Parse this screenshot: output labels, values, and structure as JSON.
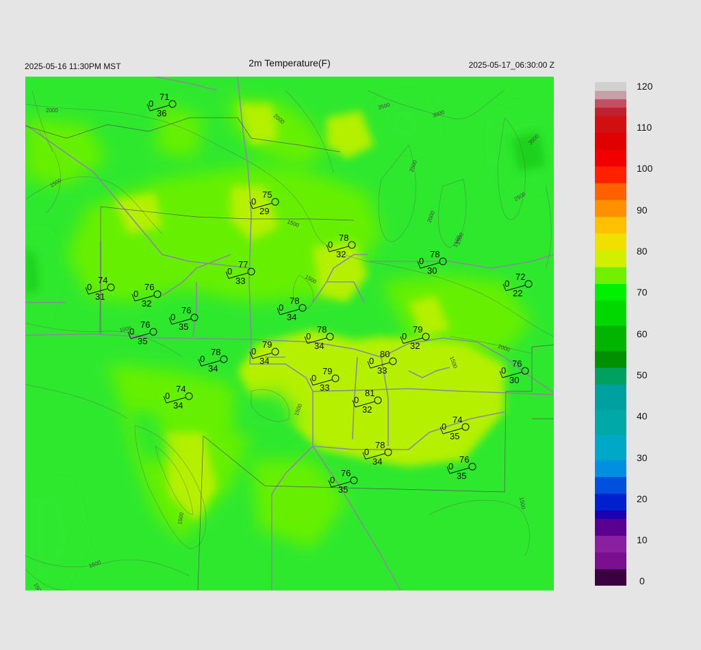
{
  "header": {
    "title": "2m Temperature(F)",
    "local_time": "2025-05-16 11:30PM MST",
    "utc_time": "2025-05-17_06:30:00 Z"
  },
  "colorbar": {
    "ticks": [
      "120",
      "110",
      "100",
      "90",
      "80",
      "70",
      "60",
      "50",
      "40",
      "30",
      "20",
      "10",
      "0"
    ],
    "range": [
      0,
      120
    ],
    "stops": [
      {
        "v": 0,
        "c": "#000000"
      },
      {
        "v": 3,
        "c": "#3a0040"
      },
      {
        "v": 8,
        "c": "#7a1090"
      },
      {
        "v": 12,
        "c": "#8a20a0"
      },
      {
        "v": 15,
        "c": "#5a0090"
      },
      {
        "v": 18,
        "c": "#1a00b0"
      },
      {
        "v": 22,
        "c": "#0020d0"
      },
      {
        "v": 26,
        "c": "#0050e0"
      },
      {
        "v": 30,
        "c": "#0090e0"
      },
      {
        "v": 35,
        "c": "#00a8c8"
      },
      {
        "v": 42,
        "c": "#00a8a8"
      },
      {
        "v": 48,
        "c": "#00a0a0"
      },
      {
        "v": 52,
        "c": "#00a060"
      },
      {
        "v": 56,
        "c": "#009000"
      },
      {
        "v": 62,
        "c": "#00b400"
      },
      {
        "v": 68,
        "c": "#00d800"
      },
      {
        "v": 72,
        "c": "#00f000"
      },
      {
        "v": 76,
        "c": "#70f000"
      },
      {
        "v": 80,
        "c": "#d0f000"
      },
      {
        "v": 84,
        "c": "#f0e000"
      },
      {
        "v": 88,
        "c": "#ffc000"
      },
      {
        "v": 92,
        "c": "#ff9000"
      },
      {
        "v": 96,
        "c": "#ff6000"
      },
      {
        "v": 100,
        "c": "#ff2000"
      },
      {
        "v": 104,
        "c": "#f00000"
      },
      {
        "v": 108,
        "c": "#e00000"
      },
      {
        "v": 112,
        "c": "#d01010"
      },
      {
        "v": 114,
        "c": "#c02030"
      },
      {
        "v": 116,
        "c": "#c05060"
      },
      {
        "v": 118,
        "c": "#c8a0a8"
      },
      {
        "v": 120,
        "c": "#d0d0d0"
      }
    ]
  },
  "map": {
    "field_colors": {
      "cool": "#2ee82e",
      "mid": "#66f000",
      "warm": "#b4f000",
      "cold": "#1ad21a"
    },
    "contour_labels": [
      "2000",
      "2000",
      "3500",
      "3000",
      "3500",
      "2500",
      "2500",
      "2000",
      "1500",
      "1500",
      "1500",
      "1500",
      "1000",
      "1500",
      "2000",
      "1500",
      "1500",
      "1500",
      "1500",
      "1500",
      "1500"
    ],
    "stations": [
      {
        "t": "71",
        "d": "36",
        "z": "0"
      },
      {
        "t": "75",
        "d": "29",
        "z": "0"
      },
      {
        "t": "78",
        "d": "32",
        "z": "0"
      },
      {
        "t": "77",
        "d": "33",
        "z": "0"
      },
      {
        "t": "78",
        "d": "30",
        "z": "0"
      },
      {
        "t": "74",
        "d": "31",
        "z": "0"
      },
      {
        "t": "76",
        "d": "32",
        "z": "0"
      },
      {
        "t": "72",
        "d": "22",
        "z": "0"
      },
      {
        "t": "78",
        "d": "34",
        "z": "0"
      },
      {
        "t": "76",
        "d": "35",
        "z": "0"
      },
      {
        "t": "76",
        "d": "35",
        "z": "0"
      },
      {
        "t": "78",
        "d": "34",
        "z": "0"
      },
      {
        "t": "79",
        "d": "32",
        "z": "0"
      },
      {
        "t": "79",
        "d": "34",
        "z": "0"
      },
      {
        "t": "78",
        "d": "34",
        "z": "0"
      },
      {
        "t": "80",
        "d": "33",
        "z": "0"
      },
      {
        "t": "79",
        "d": "33",
        "z": "0"
      },
      {
        "t": "76",
        "d": "30",
        "z": "0"
      },
      {
        "t": "74",
        "d": "34",
        "z": "0"
      },
      {
        "t": "81",
        "d": "32",
        "z": "0"
      },
      {
        "t": "74",
        "d": "35",
        "z": "0"
      },
      {
        "t": "78",
        "d": "34",
        "z": "0"
      },
      {
        "t": "76",
        "d": "35",
        "z": "0"
      },
      {
        "t": "76",
        "d": "35",
        "z": "0"
      }
    ]
  }
}
